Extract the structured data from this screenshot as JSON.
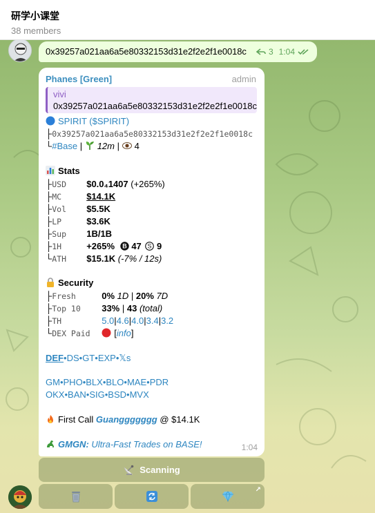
{
  "header": {
    "title": "研学小课堂",
    "subtitle": "38 members"
  },
  "top_message": {
    "text": "0x39257a021aa6a5e80332153d31e2f2e2f1e0018c",
    "reply_count": "3",
    "time": "1:04"
  },
  "main_message": {
    "sender": "Phanes [Green]",
    "role": "admin",
    "reply": {
      "name": "vivi",
      "text": "0x39257a021aa6a5e80332153d31e2f2e2f1e0018c"
    },
    "token_line": {
      "name": "SPIRIT",
      "open": " (",
      "ticker": "$SPIRIT",
      "close": ")"
    },
    "address_line": {
      "prefix": "├",
      "address": "0x39257a021aa6a5e80332153d31e2f2e2f1e0018c"
    },
    "chain_line": {
      "prefix": "└",
      "chain": "#Base",
      "sep": " | ",
      "age": "12m",
      "sep2": " | ",
      "views": "4"
    },
    "stats": {
      "title": "Stats",
      "rows": [
        {
          "prefix": "├",
          "key": "USD",
          "value": "$0.0₄1407",
          "extra": " (+265%)"
        },
        {
          "prefix": "├",
          "key": "MC",
          "value": "$14.1K",
          "extra": ""
        },
        {
          "prefix": "├",
          "key": "Vol",
          "value": "$5.5K",
          "extra": ""
        },
        {
          "prefix": "├",
          "key": "LP",
          "value": "$3.6K",
          "extra": ""
        },
        {
          "prefix": "├",
          "key": "Sup",
          "value": "1B/1B",
          "extra": ""
        },
        {
          "prefix": "├",
          "key": "1H",
          "value": "+265%",
          "b_label": "B",
          "b_count": "47",
          "s_label": "S",
          "s_count": "9"
        },
        {
          "prefix": "└",
          "key": "ATH",
          "value": "$15.1K",
          "extra": "(-7% / 12s)"
        }
      ]
    },
    "security": {
      "title": "Security",
      "fresh": {
        "prefix": "├",
        "key": "Fresh",
        "v1": "0%",
        "p1": "1D",
        "sep": " | ",
        "v2": "20%",
        "p2": "7D"
      },
      "top10": {
        "prefix": "├",
        "key": "Top 10",
        "v1": "33%",
        "sep": " | ",
        "v2": "43",
        "note": "(total)"
      },
      "th": {
        "prefix": "├",
        "key": "TH",
        "values": [
          "5.0",
          "4.6",
          "4.0",
          "3.4",
          "3.2"
        ],
        "sep": "|"
      },
      "dex": {
        "prefix": "└",
        "key": "DEX Paid",
        "open": "[",
        "link": "info",
        "close": "]"
      }
    },
    "links1": [
      "DEF",
      "DS",
      "GT",
      "EXP",
      "𝕏s"
    ],
    "links2": [
      "GM",
      "PHO",
      "BLX",
      "BLO",
      "MAE",
      "PDR"
    ],
    "links3": [
      "OKX",
      "BAN",
      "SIG",
      "BSD",
      "MVX"
    ],
    "dot": "•",
    "first_call": {
      "label": "First Call",
      "user": "Guanggggggg",
      "at": "@",
      "mc": "$14.1K"
    },
    "promo": {
      "name": "GMGN:",
      "text": " Ultra-Fast Trades on BASE!"
    },
    "time": "1:04"
  },
  "keyboard": {
    "scan_label": "Scanning",
    "trash_icon": "trash-icon",
    "refresh_icon": "refresh-icon",
    "gem_icon": "gem-icon",
    "corner_icon": "↗"
  },
  "colors": {
    "link": "#2e86c0",
    "sender": "#3d8fbf",
    "reply_accent": "#8f5fc4",
    "outgoing_bubble": "#eeffde"
  }
}
